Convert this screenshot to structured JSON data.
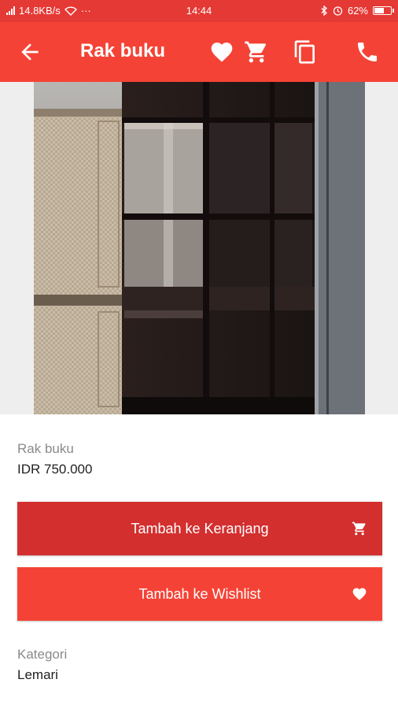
{
  "status_bar": {
    "speed": "14.8KB/s",
    "dots": "···",
    "time": "14:44",
    "battery": "62%",
    "battery_level": 0.62
  },
  "app_bar": {
    "title": "Rak buku",
    "icons": [
      "back-arrow-icon",
      "heart-icon",
      "cart-icon",
      "copy-icon",
      "phone-icon"
    ]
  },
  "product": {
    "name": "Rak buku",
    "price": "IDR 750.000",
    "image": "bookshelf-photo"
  },
  "buttons": {
    "add_to_cart": "Tambah ke Keranjang",
    "add_to_wishlist": "Tambah ke Wishlist"
  },
  "category": {
    "label": "Kategori",
    "value": "Lemari"
  },
  "colors": {
    "status_bar": "#e53935",
    "app_bar": "#f44336",
    "cart_button": "#d32f2f",
    "wishlist_button": "#f44336"
  }
}
